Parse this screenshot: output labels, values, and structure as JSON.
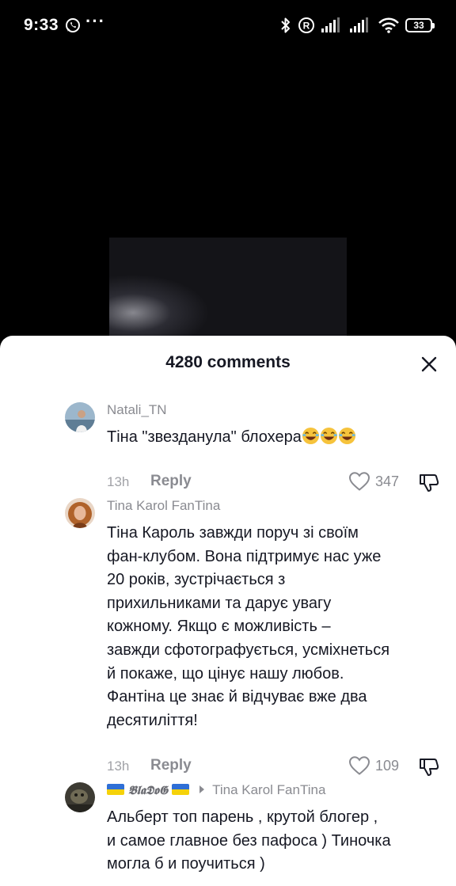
{
  "status_bar": {
    "time": "9:33",
    "more": "···",
    "battery": "33"
  },
  "sheet": {
    "title": "4280 comments"
  },
  "comments": [
    {
      "author": "Natali_TN",
      "text_lines": [
        "Тіна \"звезданула\" блохера"
      ],
      "emoji": "😂😂😂",
      "time": "13h",
      "reply": "Reply",
      "likes": "347"
    },
    {
      "author": "Tina Karol FanTina",
      "text_lines": [
        "Тіна Кароль завжди поруч зі своїм",
        "фан-клубом. Вона підтримує нас уже",
        "20 років, зустрічається з",
        "прихильниками та дарує увагу",
        "кожному. Якщо є можливість –",
        "завжди сфотографується, усміхнеться",
        "й покаже, що цінує нашу любов.",
        "Фантіна це знає й відчуває вже два",
        "десятиліття!"
      ],
      "time": "13h",
      "reply": "Reply",
      "likes": "109"
    },
    {
      "author": "𝕭𝖑𝖆𝕯𝖔𝕲",
      "reply_to": "Tina Karol FanTina",
      "text_lines": [
        "Альберт топ парень , крутой блогер ,",
        "и самое главное без пафоса ) Тиночка",
        "могла б и поучиться )"
      ]
    }
  ],
  "colors": {
    "sheet_bg": "#ffffff",
    "text": "#161823",
    "secondary": "#8a8b91",
    "screen_bg": "#000000"
  }
}
